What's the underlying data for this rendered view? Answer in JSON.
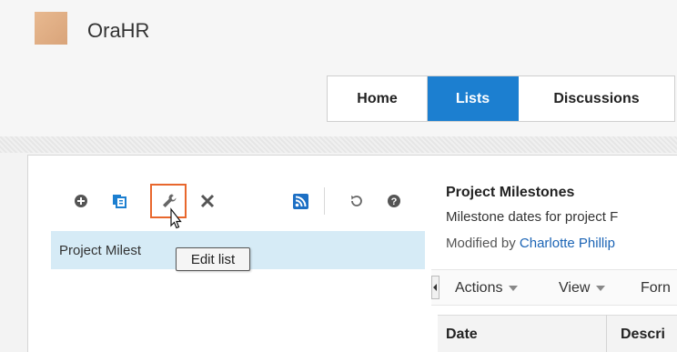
{
  "app": {
    "title": "OraHR"
  },
  "tabs": [
    {
      "label": "Home"
    },
    {
      "label": "Lists"
    },
    {
      "label": "Discussions"
    }
  ],
  "toolbar": {
    "icons": [
      "add-icon",
      "copy-icon",
      "wrench-icon",
      "close-icon",
      "rss-icon",
      "refresh-icon",
      "help-icon"
    ]
  },
  "list": {
    "selected_item": "Project Milest"
  },
  "tooltip": {
    "text": "Edit list"
  },
  "detail": {
    "title": "Project Milestones",
    "description": "Milestone dates for project F",
    "modified_prefix": "Modified by",
    "modified_by": "Charlotte Phillip"
  },
  "actions": {
    "actions_label": "Actions",
    "view_label": "View",
    "format_label": "Forn"
  },
  "columns": [
    "Date",
    "Descri"
  ],
  "colors": {
    "accent": "#1c7fd0",
    "highlight": "#e8672d",
    "selection": "#d6ebf6",
    "link": "#1b64b5"
  }
}
